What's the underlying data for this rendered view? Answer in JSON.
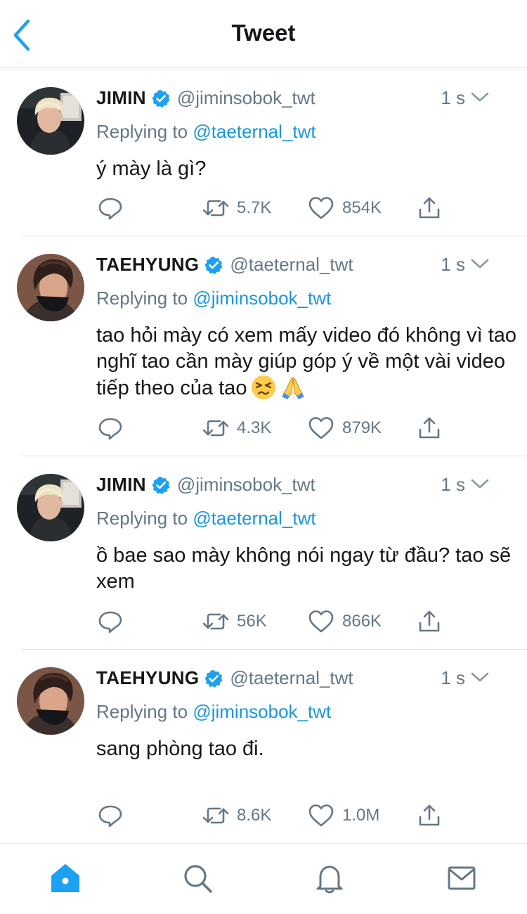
{
  "header": {
    "title": "Tweet",
    "back_icon": "chevron-left-icon"
  },
  "colors": {
    "accent": "#1da1f2",
    "mention": "#1b95e0",
    "secondary": "#657786",
    "divider": "#dfe3e6"
  },
  "tweets": [
    {
      "name": "JIMIN",
      "handle": "@jiminsobok_twt",
      "time": "1 s",
      "replying_prefix": "Replying to",
      "replying_to": "@taeternal_twt",
      "text": "ý mày là gì?",
      "retweets": "5.7K",
      "likes": "854K"
    },
    {
      "name": "TAEHYUNG",
      "handle": "@taeternal_twt",
      "time": "1 s",
      "replying_prefix": "Replying to",
      "replying_to": "@jiminsobok_twt",
      "text": "tao hỏi mày có xem mấy video đó không vì tao nghĩ tao cần mày giúp góp ý về một vài video tiếp theo của tao",
      "emojis": [
        "persevering-face-emoji",
        "folded-hands-emoji"
      ],
      "retweets": "4.3K",
      "likes": "879K"
    },
    {
      "name": "JIMIN",
      "handle": "@jiminsobok_twt",
      "time": "1 s",
      "replying_prefix": "Replying to",
      "replying_to": "@taeternal_twt",
      "text": "ồ bae sao mày không nói ngay từ đầu? tao sẽ xem",
      "retweets": "56K",
      "likes": "866K"
    },
    {
      "name": "TAEHYUNG",
      "handle": "@taeternal_twt",
      "time": "1 s",
      "replying_prefix": "Replying to",
      "replying_to": "@jiminsobok_twt",
      "text": "sang phòng tao đi.",
      "retweets": "8.6K",
      "likes": "1.0M"
    }
  ],
  "tabbar": {
    "items": [
      "home-icon",
      "search-icon",
      "bell-icon",
      "mail-icon"
    ],
    "active": "home-icon"
  }
}
